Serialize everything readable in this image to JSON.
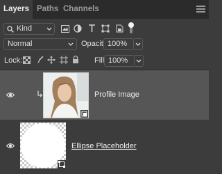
{
  "tabs": [
    {
      "label": "Layers"
    },
    {
      "label": "Paths"
    },
    {
      "label": "Channels"
    }
  ],
  "filter": {
    "kind_label": "Kind"
  },
  "blend": {
    "mode": "Normal"
  },
  "opacity": {
    "label": "Opacity:",
    "value": "100%"
  },
  "lock": {
    "label": "Lock:"
  },
  "fill": {
    "label": "Fill:",
    "value": "100%"
  },
  "layers": [
    {
      "name": "Profile Image",
      "selected": true,
      "visible": true,
      "clipped": true
    },
    {
      "name": "Ellipse Placeholder",
      "selected": false,
      "visible": true
    }
  ],
  "colors": {
    "panel": "#3c3c3c",
    "selected_row": "#565656",
    "tab_bar": "#2b2b2b"
  }
}
